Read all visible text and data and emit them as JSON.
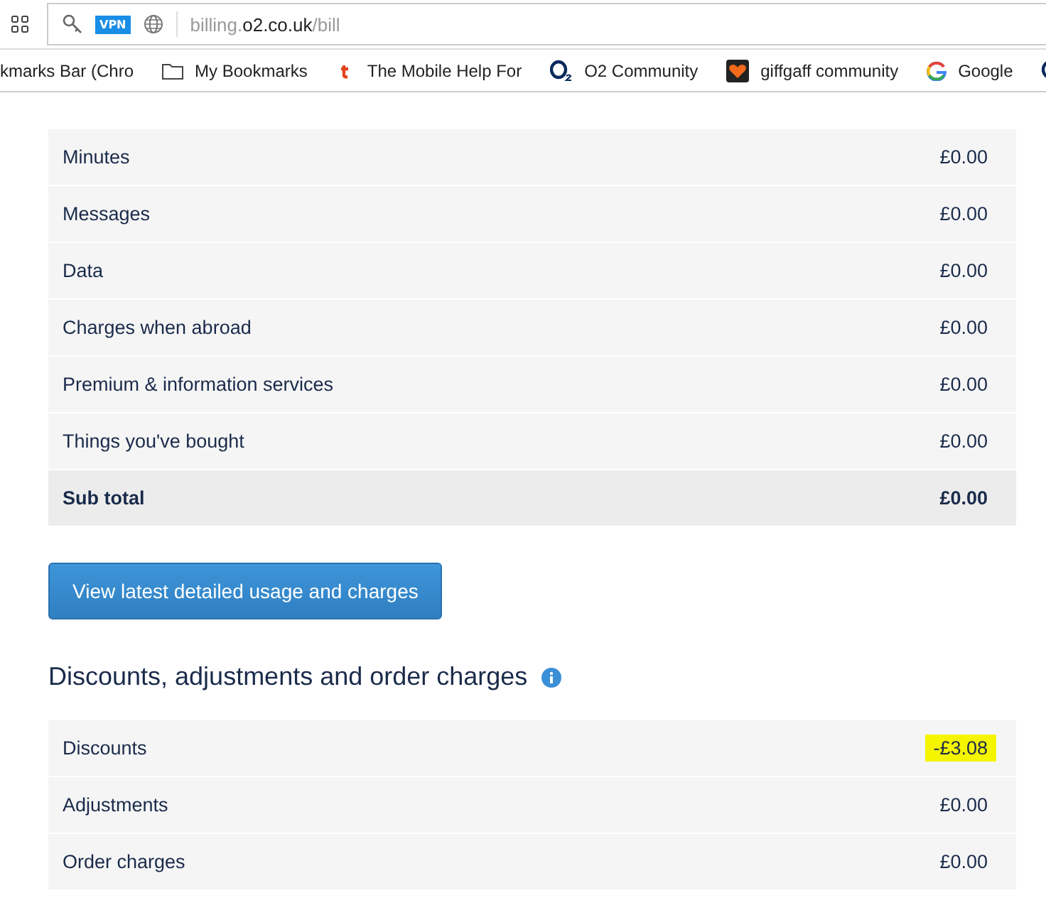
{
  "address_bar": {
    "badge": "VPN",
    "url_host_prefix": "billing.",
    "url_domain": "o2.co.uk",
    "url_path": "/bill"
  },
  "bookmarks": [
    {
      "label": "kmarks Bar (Chro",
      "kind": "none"
    },
    {
      "label": "My Bookmarks",
      "kind": "folder"
    },
    {
      "label": "The Mobile Help For",
      "kind": "t"
    },
    {
      "label": "O2 Community",
      "kind": "o2"
    },
    {
      "label": "giffgaff community",
      "kind": "heart"
    },
    {
      "label": "Google",
      "kind": "g"
    },
    {
      "kind": "o2"
    }
  ],
  "charges": {
    "rows": [
      {
        "label": "Minutes",
        "amount": "£0.00"
      },
      {
        "label": "Messages",
        "amount": "£0.00"
      },
      {
        "label": "Data",
        "amount": "£0.00"
      },
      {
        "label": "Charges when abroad",
        "amount": "£0.00"
      },
      {
        "label": "Premium & information services",
        "amount": "£0.00"
      },
      {
        "label": "Things you've bought",
        "amount": "£0.00"
      }
    ],
    "subtotal": {
      "label": "Sub total",
      "amount": "£0.00"
    }
  },
  "usage_button": "View latest detailed usage and charges",
  "discounts": {
    "title": "Discounts, adjustments and order charges",
    "rows": [
      {
        "label": "Discounts",
        "amount": "-£3.08",
        "highlighted": true
      },
      {
        "label": "Adjustments",
        "amount": "£0.00",
        "highlighted": false
      },
      {
        "label": "Order charges",
        "amount": "£0.00",
        "highlighted": false
      }
    ]
  }
}
